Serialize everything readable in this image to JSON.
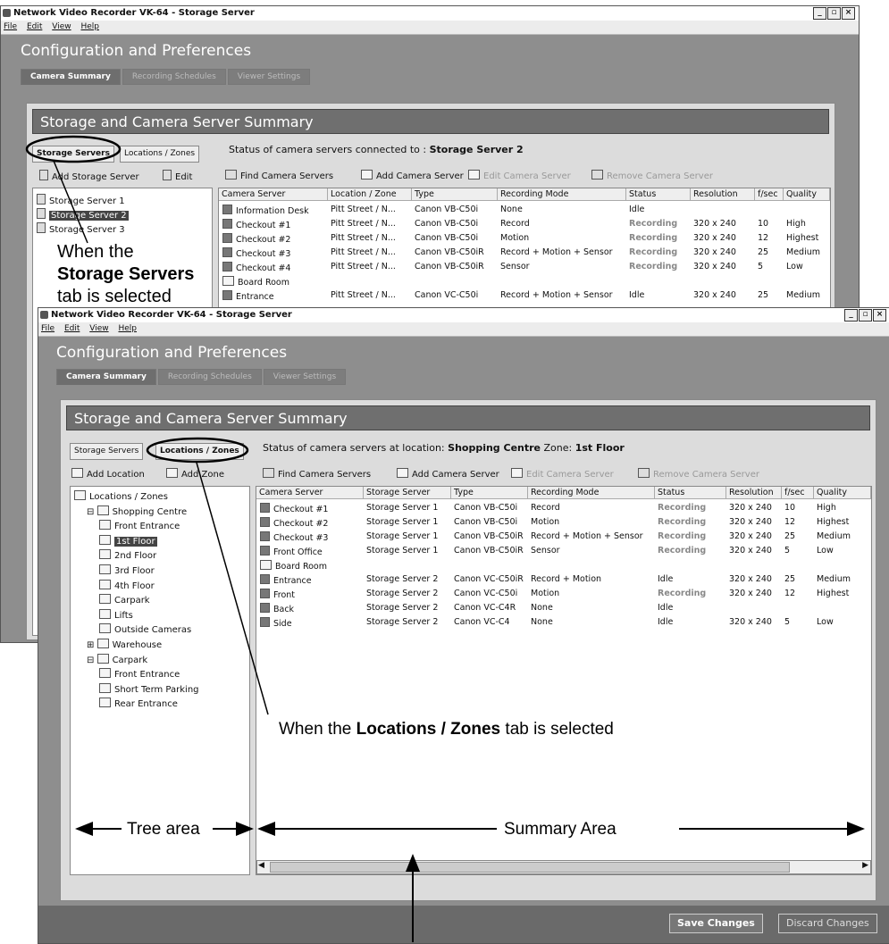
{
  "window1": {
    "title": "Network Video Recorder VK-64 - Storage Server",
    "menu": [
      "File",
      "Edit",
      "View",
      "Help"
    ],
    "app_title": "Configuration and Preferences",
    "tabs": [
      "Camera Summary",
      "Recording Schedules",
      "Viewer Settings"
    ],
    "panel_title": "Storage and Camera Server Summary",
    "subtabs": [
      "Storage Servers",
      "Locations / Zones"
    ],
    "tree_buttons": [
      "Add Storage Server",
      "Edit"
    ],
    "tree": [
      "Storage Server 1",
      "Storage Server 2",
      "Storage Server 3"
    ],
    "status_prefix": "Status of camera servers connected to : ",
    "status_value": "Storage Server 2",
    "toolbar": [
      "Find Camera Servers",
      "Add Camera Server",
      "Edit Camera Server",
      "Remove Camera Server"
    ],
    "columns": [
      "Camera Server",
      "Location / Zone",
      "Type",
      "Recording Mode",
      "Status",
      "Resolution",
      "f/sec",
      "Quality"
    ],
    "rows": [
      [
        "Information Desk",
        "Pitt Street / N...",
        "Canon VB-C50i",
        "None",
        "Idle",
        "",
        "",
        ""
      ],
      [
        "Checkout #1",
        "Pitt Street / N...",
        "Canon VB-C50i",
        "Record",
        "Recording",
        "320 x 240",
        "10",
        "High"
      ],
      [
        "Checkout #2",
        "Pitt Street / N...",
        "Canon VB-C50i",
        "Motion",
        "Recording",
        "320 x 240",
        "12",
        "Highest"
      ],
      [
        "Checkout #3",
        "Pitt Street / N...",
        "Canon VB-C50iR",
        "Record + Motion + Sensor",
        "Recording",
        "320 x 240",
        "25",
        "Medium"
      ],
      [
        "Checkout #4",
        "Pitt Street / N...",
        "Canon VB-C50iR",
        "Sensor",
        "Recording",
        "320 x 240",
        "5",
        "Low"
      ],
      [
        "Board Room",
        "",
        "",
        "",
        "",
        "",
        "",
        ""
      ],
      [
        "Entrance",
        "Pitt Street / N...",
        "Canon VC-C50i",
        "Record + Motion + Sensor",
        "Idle",
        "320 x 240",
        "25",
        "Medium"
      ]
    ]
  },
  "window2": {
    "title": "Network Video Recorder VK-64 - Storage Server",
    "menu": [
      "File",
      "Edit",
      "View",
      "Help"
    ],
    "app_title": "Configuration and Preferences",
    "tabs": [
      "Camera Summary",
      "Recording Schedules",
      "Viewer Settings"
    ],
    "panel_title": "Storage and Camera Server Summary",
    "subtabs": [
      "Storage Servers",
      "Locations / Zones"
    ],
    "tree_buttons": [
      "Add Location",
      "Add Zone"
    ],
    "tree": [
      "Locations / Zones",
      "Shopping Centre",
      "Front Entrance",
      "1st Floor",
      "2nd Floor",
      "3rd Floor",
      "4th Floor",
      "Carpark",
      "Lifts",
      "Outside Cameras",
      "Warehouse",
      "Carpark",
      "Front Entrance",
      "Short Term Parking",
      "Rear Entrance"
    ],
    "status_prefix": "Status of camera servers at location: ",
    "status_location": "Shopping Centre",
    "status_zone_label": "Zone: ",
    "status_zone": "1st Floor",
    "toolbar": [
      "Find Camera Servers",
      "Add Camera Server",
      "Edit Camera Server",
      "Remove Camera Server"
    ],
    "columns": [
      "Camera Server",
      "Storage Server",
      "Type",
      "Recording Mode",
      "Status",
      "Resolution",
      "f/sec",
      "Quality"
    ],
    "rows": [
      [
        "Checkout #1",
        "Storage Server 1",
        "Canon VB-C50i",
        "Record",
        "Recording",
        "320 x 240",
        "10",
        "High"
      ],
      [
        "Checkout #2",
        "Storage Server 1",
        "Canon VB-C50i",
        "Motion",
        "Recording",
        "320 x 240",
        "12",
        "Highest"
      ],
      [
        "Checkout #3",
        "Storage Server 1",
        "Canon VB-C50iR",
        "Record + Motion + Sensor",
        "Recording",
        "320 x 240",
        "25",
        "Medium"
      ],
      [
        "Front Office",
        "Storage Server 1",
        "Canon VB-C50iR",
        "Sensor",
        "Recording",
        "320 x 240",
        "5",
        "Low"
      ],
      [
        "Board Room",
        "",
        "",
        "",
        "",
        "",
        "",
        ""
      ],
      [
        "Entrance",
        "Storage Server 2",
        "Canon VC-C50iR",
        "Record + Motion",
        "Idle",
        "320 x 240",
        "25",
        "Medium"
      ],
      [
        "Front",
        "Storage Server 2",
        "Canon VC-C50i",
        "Motion",
        "Recording",
        "320 x 240",
        "12",
        "Highest"
      ],
      [
        "Back",
        "Storage Server 2",
        "Canon VC-C4R",
        "None",
        "Idle",
        "",
        "",
        ""
      ],
      [
        "Side",
        "Storage Server 2",
        "Canon VC-C4",
        "None",
        "Idle",
        "320 x 240",
        "5",
        "Low"
      ]
    ],
    "save_button": "Save Changes",
    "discard_button": "Discard Changes"
  },
  "annotations": {
    "storage_line1": "When the",
    "storage_bold": "Storage Servers",
    "storage_line3": "tab is selected",
    "locations_prefix": "When the ",
    "locations_bold": "Locations / Zones",
    "locations_suffix": " tab is selected",
    "tree_area": "Tree area",
    "summary_area": "Summary Area"
  }
}
